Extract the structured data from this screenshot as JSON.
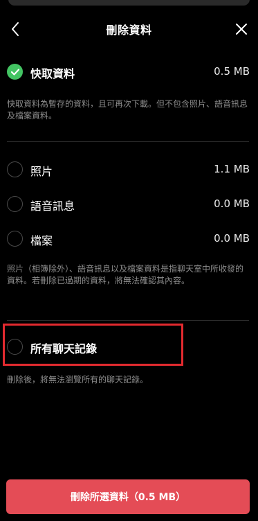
{
  "header": {
    "title": "刪除資料",
    "back_icon": "chevron-left-icon",
    "close_icon": "close-icon"
  },
  "items": [
    {
      "label": "快取資料",
      "size": "0.5 MB",
      "checked": true
    },
    {
      "label": "照片",
      "size": "1.1 MB",
      "checked": false
    },
    {
      "label": "語音訊息",
      "size": "0.0 MB",
      "checked": false
    },
    {
      "label": "檔案",
      "size": "0.0 MB",
      "checked": false
    },
    {
      "label": "所有聊天記錄",
      "size": "",
      "checked": false
    }
  ],
  "descriptions": {
    "cache": "快取資料為暫存的資料，且可再次下載。但不包含照片、語音訊息及檔案資料。",
    "media": "照片（相簿除外）、語音訊息以及檔案資料是指聊天室中所收發的資料。若刪除已過期的資料，將無法確認其內容。",
    "chat": "刪除後，將無法瀏覽所有的聊天記錄。"
  },
  "delete_button": {
    "label": "刪除所選資料（0.5 MB）"
  },
  "colors": {
    "background": "#000000",
    "checked": "#43c463",
    "cta": "#e44c56",
    "highlight_border": "#e32a2f"
  }
}
